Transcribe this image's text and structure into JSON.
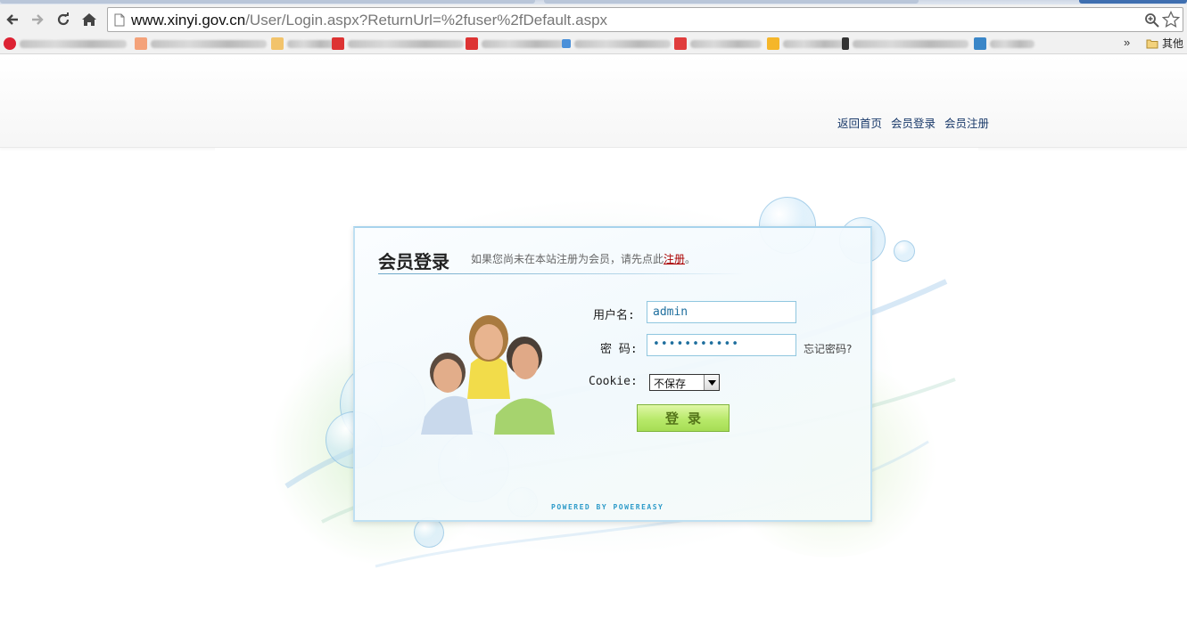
{
  "browser": {
    "url_host": "www.xinyi.gov.cn",
    "url_path": "/User/Login.aspx?ReturnUrl=%2fuser%2fDefault.aspx",
    "bookmarks_more": "»",
    "bookmarks_folder": "其他"
  },
  "header": {
    "links": [
      "返回首页",
      "会员登录",
      "会员注册"
    ]
  },
  "login": {
    "title": "会员登录",
    "hint_prefix": "如果您尚未在本站注册为会员，请先点此",
    "hint_link": "注册",
    "hint_suffix": "。",
    "username_label": "用户名:",
    "username_value": "admin",
    "password_label": "密  码:",
    "password_value": "•••••••••••",
    "forgot_link": "忘记密码?",
    "cookie_label": "Cookie:",
    "cookie_selected": "不保存",
    "submit_label": "登录",
    "powered_by": "POWERED BY POWEREASY"
  },
  "colors": {
    "accent_border": "#bfe0f2",
    "link_red": "#aa0000",
    "button_green": "#b8e96a"
  }
}
